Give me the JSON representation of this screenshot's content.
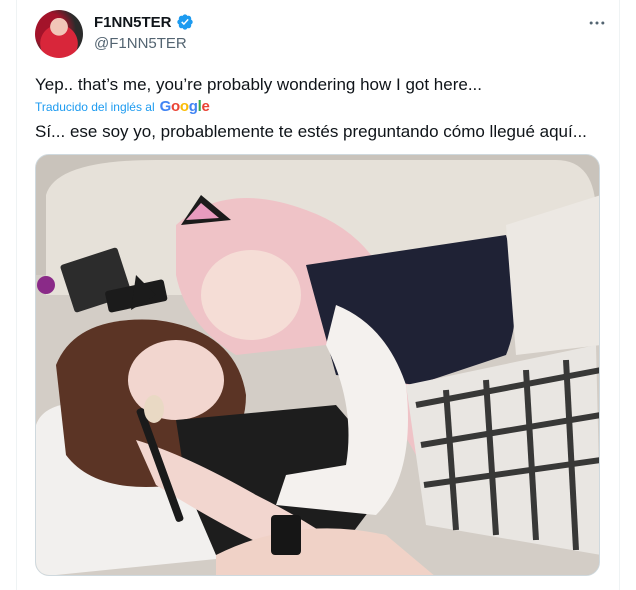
{
  "tweet": {
    "author": {
      "display_name": "F1NN5TER",
      "handle": "@F1NN5TER",
      "verified": true,
      "avatar_icon": "profile-avatar"
    },
    "more_icon": "more-dots-icon",
    "text_original": "Yep.. that’s me, you’re probably wondering how I got here...",
    "translation": {
      "label": "Traducido del inglés al",
      "provider_letters": [
        "G",
        "o",
        "o",
        "g",
        "l",
        "e"
      ]
    },
    "text_translated": "Sí... ese soy yo, probablemente te estés preguntando cómo llegué aquí...",
    "media": {
      "type": "photo"
    }
  },
  "colors": {
    "text_primary": "#0f1419",
    "text_secondary": "#536471",
    "link_blue": "#1d9bf0",
    "verified_blue": "#1d9bf0",
    "border": "#cfd9de"
  }
}
